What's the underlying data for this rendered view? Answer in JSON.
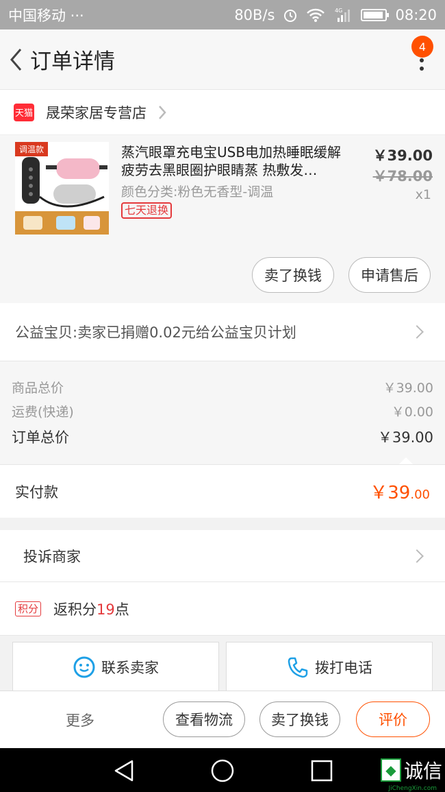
{
  "status_bar": {
    "carrier": "中国移动 ···",
    "speed": "80B/s",
    "network": "4G",
    "time": "08:20"
  },
  "header": {
    "title": "订单详情",
    "badge_count": "4"
  },
  "shop": {
    "platform": "天猫",
    "name": "晟荣家居专营店"
  },
  "product": {
    "thumb_tag": "调温款",
    "title": "蒸汽眼罩充电宝USB电加热睡眠缓解疲劳去黑眼圈护眼睛蒸 热敷发…",
    "sku": "颜色分类:粉色无香型-调温",
    "return_tag": "七天退换",
    "price": "￥39.00",
    "original_price": "￥78.00",
    "quantity": "x1",
    "sell_button": "卖了换钱",
    "after_sale_button": "申请售后"
  },
  "charity": {
    "text": "公益宝贝:卖家已捐赠0.02元给公益宝贝计划"
  },
  "totals": {
    "goods_label": "商品总价",
    "goods_value": "￥39.00",
    "shipping_label": "运费(快递)",
    "shipping_value": "￥0.00",
    "order_label": "订单总价",
    "order_value": "￥39.00"
  },
  "paid": {
    "label": "实付款",
    "currency": "￥",
    "integer": "39",
    "decimal": ".00"
  },
  "complaint": {
    "text": "投诉商家"
  },
  "points": {
    "icon_label": "积分",
    "prefix": "返积分",
    "value": "19",
    "suffix": "点"
  },
  "contact": {
    "seller": "联系卖家",
    "phone": "拨打电话"
  },
  "actions": {
    "more": "更多",
    "logistics": "查看物流",
    "sell": "卖了换钱",
    "rate": "评价"
  },
  "watermark": {
    "text": "诚信",
    "sub": "JiChengXin.com"
  },
  "colors": {
    "accent": "#ff5000",
    "tmall_red": "#ff2d37",
    "tag_red": "#e4393c"
  }
}
